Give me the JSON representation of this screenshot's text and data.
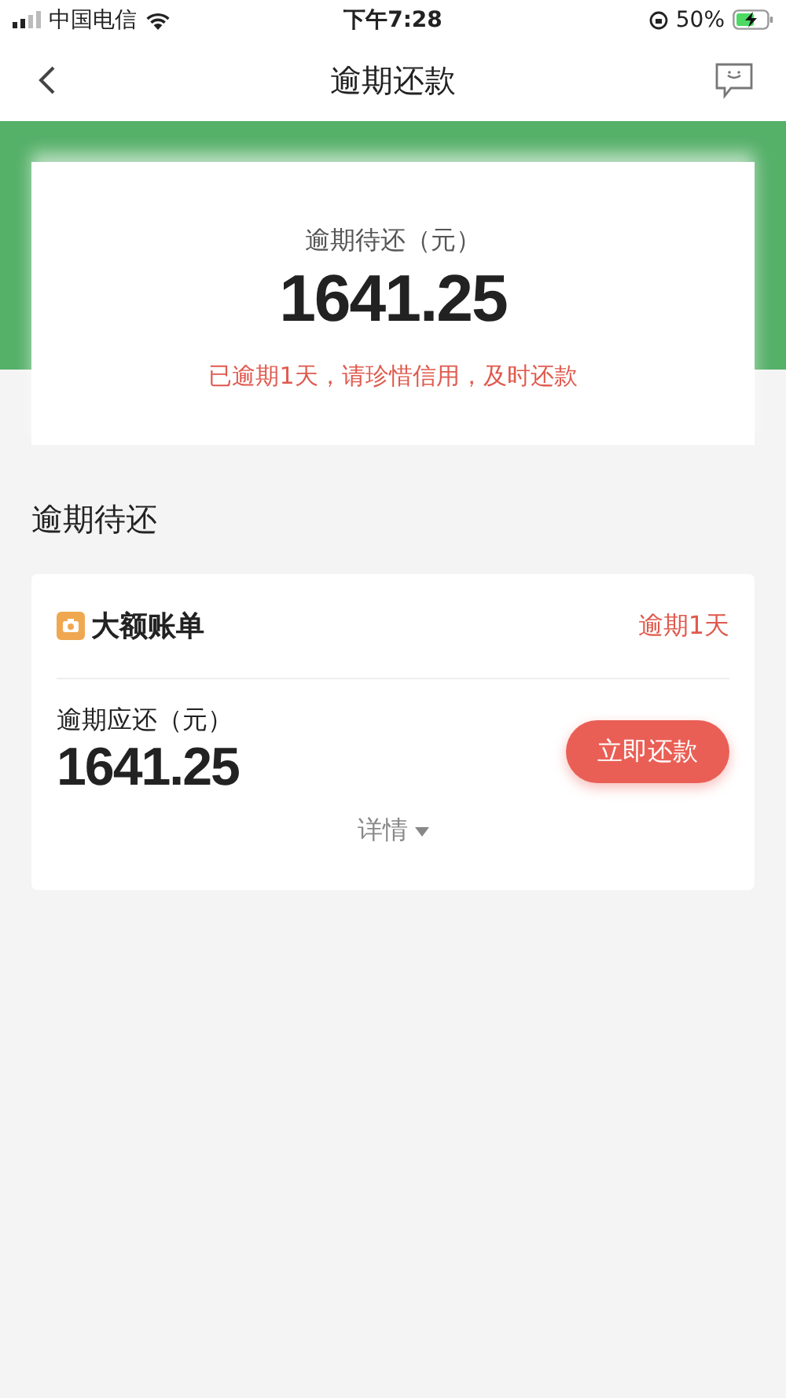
{
  "status_bar": {
    "carrier": "中国电信",
    "time": "下午7:28",
    "battery": "50%"
  },
  "nav": {
    "title": "逾期还款"
  },
  "summary": {
    "label": "逾期待还（元）",
    "amount": "1641.25",
    "warning": "已逾期1天，请珍惜信用，及时还款"
  },
  "section_title": "逾期待还",
  "bills": [
    {
      "name": "大额账单",
      "status": "逾期1天",
      "amount_label": "逾期应还（元）",
      "amount": "1641.25",
      "button": "立即还款",
      "details": "详情",
      "expanded": false
    }
  ]
}
